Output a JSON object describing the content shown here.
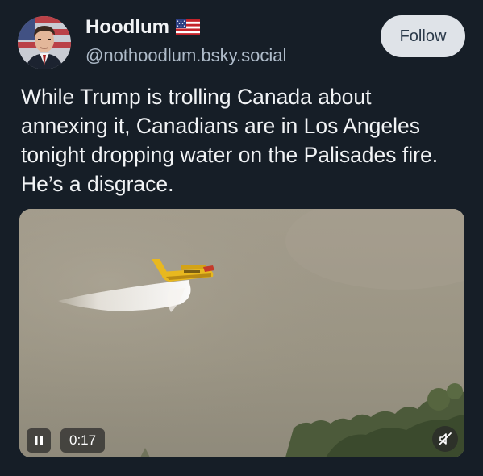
{
  "author": {
    "display_name": "Hoodlum",
    "handle": "@nothoodlum.bsky.social",
    "badge_icon": "us-flag-icon"
  },
  "follow_button": {
    "label": "Follow"
  },
  "post": {
    "text": "While Trump is trolling Canada about annexing it, Canadians are in Los Angeles tonight dropping water on the Palisades fire. He’s a disgrace."
  },
  "video": {
    "timestamp": "0:17",
    "playing": true,
    "muted": true,
    "controls": {
      "pause_icon": "pause-icon",
      "mute_icon": "speaker-muted-icon"
    }
  },
  "colors": {
    "background": "#161e27",
    "text": "#f1f3f5",
    "handle": "#aebbc9",
    "follow_bg": "#dfe3e8",
    "follow_text": "#2b3a4a"
  }
}
